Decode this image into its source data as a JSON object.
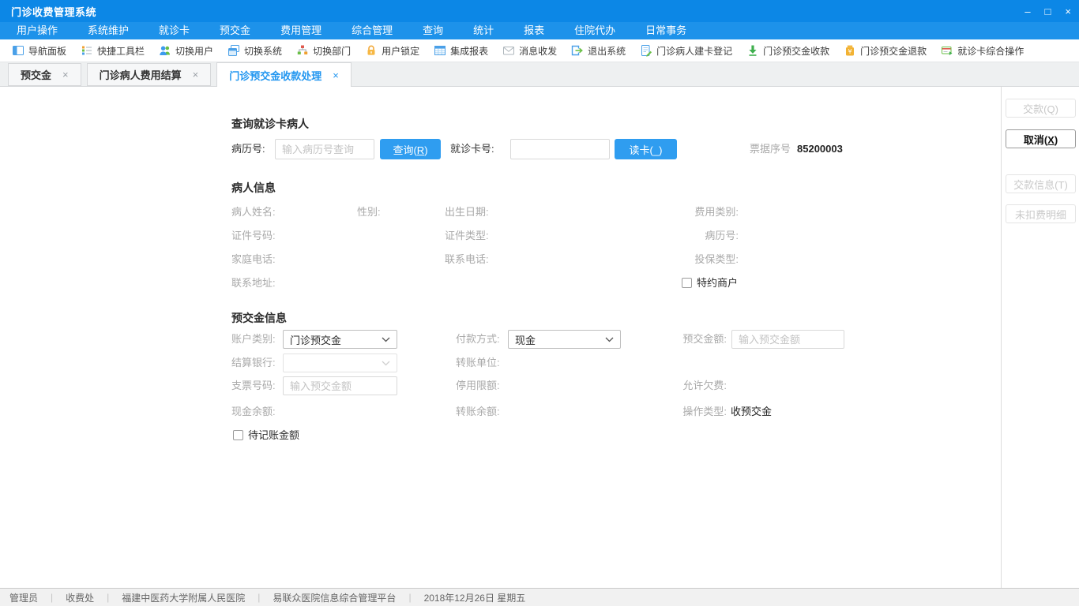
{
  "colors": {
    "titlebar": "#0c87e6",
    "menubar": "#1d92ea",
    "accent": "#2196f0",
    "primary-btn": "#2f9df0"
  },
  "window": {
    "title": "门诊收费管理系统",
    "controls": {
      "minimize": "–",
      "maximize": "□",
      "close": "×"
    }
  },
  "menu": {
    "items": [
      "用户操作",
      "系统维护",
      "就诊卡",
      "预交金",
      "费用管理",
      "综合管理",
      "查询",
      "统计",
      "报表",
      "住院代办",
      "日常事务"
    ]
  },
  "toolbar": {
    "items": [
      {
        "label": "导航面板",
        "icon": "nav-panel-icon"
      },
      {
        "label": "快捷工具栏",
        "icon": "quick-toolbar-icon"
      },
      {
        "label": "切换用户",
        "icon": "switch-user-icon"
      },
      {
        "label": "切换系统",
        "icon": "switch-system-icon"
      },
      {
        "label": "切换部门",
        "icon": "switch-dept-icon"
      },
      {
        "label": "用户锁定",
        "icon": "user-lock-icon"
      },
      {
        "label": "集成报表",
        "icon": "integrated-report-icon"
      },
      {
        "label": "消息收发",
        "icon": "message-icon"
      },
      {
        "label": "退出系统",
        "icon": "exit-system-icon"
      },
      {
        "label": "门诊病人建卡登记",
        "icon": "patient-card-register-icon"
      },
      {
        "label": "门诊预交金收款",
        "icon": "prepay-collect-icon"
      },
      {
        "label": "门诊预交金退款",
        "icon": "prepay-refund-icon"
      },
      {
        "label": "就诊卡综合操作",
        "icon": "card-combined-ops-icon"
      }
    ]
  },
  "tabs": [
    {
      "label": "预交金",
      "close": "×"
    },
    {
      "label": "门诊病人费用结算",
      "close": "×"
    },
    {
      "label": "门诊预交金收款处理",
      "close": "×"
    }
  ],
  "query": {
    "title": "查询就诊卡病人",
    "mrn_label": "病历号:",
    "mrn_placeholder": "输入病历号查询",
    "search_pre": "查询(",
    "search_key": "R",
    "search_post": ")",
    "card_label": "就诊卡号:",
    "read_pre": "读卡(",
    "read_key": "_",
    "read_post": ")",
    "receipt_label": "票据序号",
    "receipt_value": "85200003"
  },
  "patient": {
    "title": "病人信息",
    "name": "病人姓名:",
    "gender": "性别:",
    "birth": "出生日期:",
    "fee_type": "费用类别:",
    "id_no": "证件号码:",
    "id_type": "证件类型:",
    "mrn": "病历号:",
    "home_phone": "家庭电话:",
    "contact_phone": "联系电话:",
    "insure_type": "投保类型:",
    "address": "联系地址:",
    "special_merchant": "特约商户"
  },
  "prepay": {
    "title": "预交金信息",
    "account_type_label": "账户类别:",
    "account_type_value": "门诊预交金",
    "pay_method_label": "付款方式:",
    "pay_method_value": "现金",
    "amount_label": "预交金额:",
    "amount_placeholder": "输入预交金额",
    "bank_label": "结算银行:",
    "transfer_unit_label": "转账单位:",
    "check_label": "支票号码:",
    "check_placeholder": "输入预交金额",
    "stop_limit_label": "停用限额:",
    "allow_debt_label": "允许欠费:",
    "cash_balance_label": "现金余额:",
    "transfer_balance_label": "转账余额:",
    "op_type_label": "操作类型:",
    "op_type_value": "收预交金",
    "pending_label": "待记账金额"
  },
  "actions": {
    "pay_pre": "交款(",
    "pay_key": "Q",
    "pay_post": ")",
    "cancel_pre": "取消(",
    "cancel_key": "X",
    "cancel_post": ")",
    "payinfo_pre": "交款信息(",
    "payinfo_key": "T",
    "payinfo_post": ")",
    "undeducted": "未扣费明细"
  },
  "statusbar": {
    "sep": "|",
    "items": [
      "管理员",
      "收费处",
      "福建中医药大学附属人民医院",
      "易联众医院信息综合管理平台",
      "2018年12月26日 星期五"
    ]
  }
}
